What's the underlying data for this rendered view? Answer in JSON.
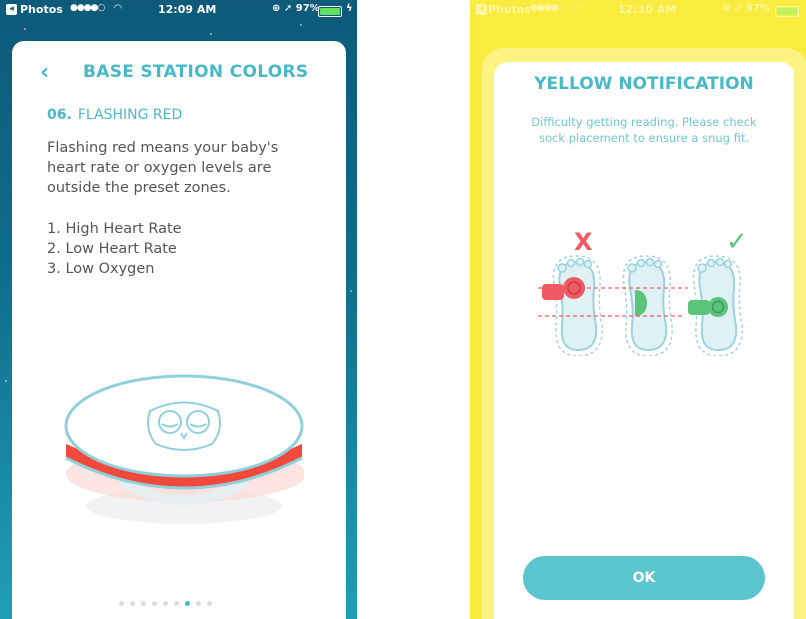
{
  "left_screen": {
    "status_bar": {
      "back_app": "Photos",
      "signal": "●●●●○",
      "time": "12:09 AM",
      "right_icons": "⊕ ➚",
      "battery": "97%"
    },
    "nav": {
      "back_icon": "chevron-left-icon",
      "title": "BASE STATION COLORS"
    },
    "step": {
      "number": "06.",
      "label": "FLASHING RED"
    },
    "description": "Flashing red means your baby's heart rate or oxygen levels are outside the preset zones.",
    "list": [
      "1. High Heart Rate",
      "2. Low Heart Rate",
      "3. Low Oxygen"
    ],
    "pagination": {
      "total": 9,
      "active": 7
    },
    "colors": {
      "accent": "#49b9c7",
      "alert_red": "#f2493d"
    }
  },
  "right_screen": {
    "status_bar": {
      "back_app": "Photos",
      "signal": "●●●●○",
      "time": "12:10 AM",
      "right_icons": "⊕ ➚",
      "battery": "97%"
    },
    "title": "YELLOW NOTIFICATION",
    "message": "Difficulty getting reading. Please check sock placement to ensure a snug fit.",
    "feet_labels": {
      "wrong": "X",
      "right": "✓"
    },
    "ok_label": "OK",
    "colors": {
      "background": "#f9ec3f",
      "wrong": "#f05a63",
      "right": "#5bc47a"
    }
  }
}
